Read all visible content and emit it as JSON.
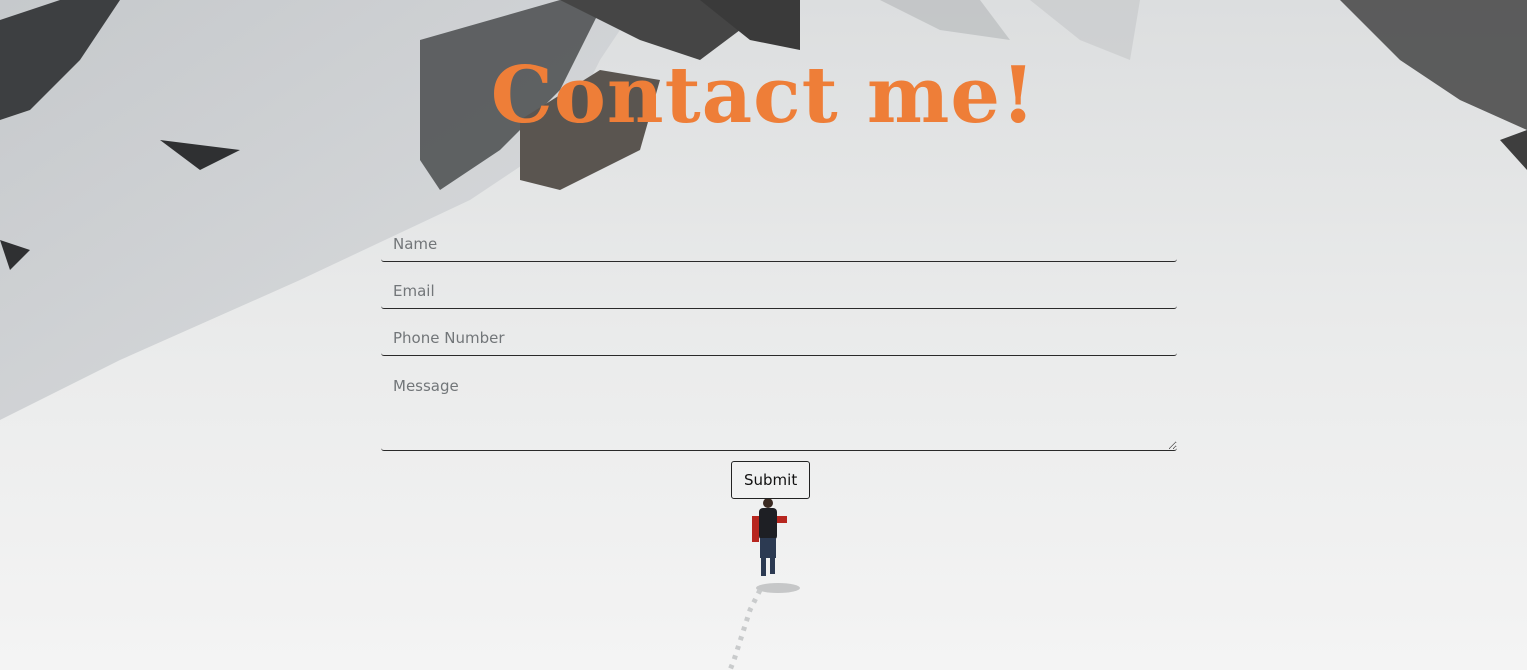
{
  "page": {
    "title": "Contact me!",
    "title_color": "#ee7e38"
  },
  "form": {
    "name_placeholder": "Name",
    "email_placeholder": "Email",
    "phone_placeholder": "Phone Number",
    "message_placeholder": "Message",
    "submit_label": "Submit"
  },
  "background": {
    "icon": "snowy-mountain-hiker-photo"
  }
}
